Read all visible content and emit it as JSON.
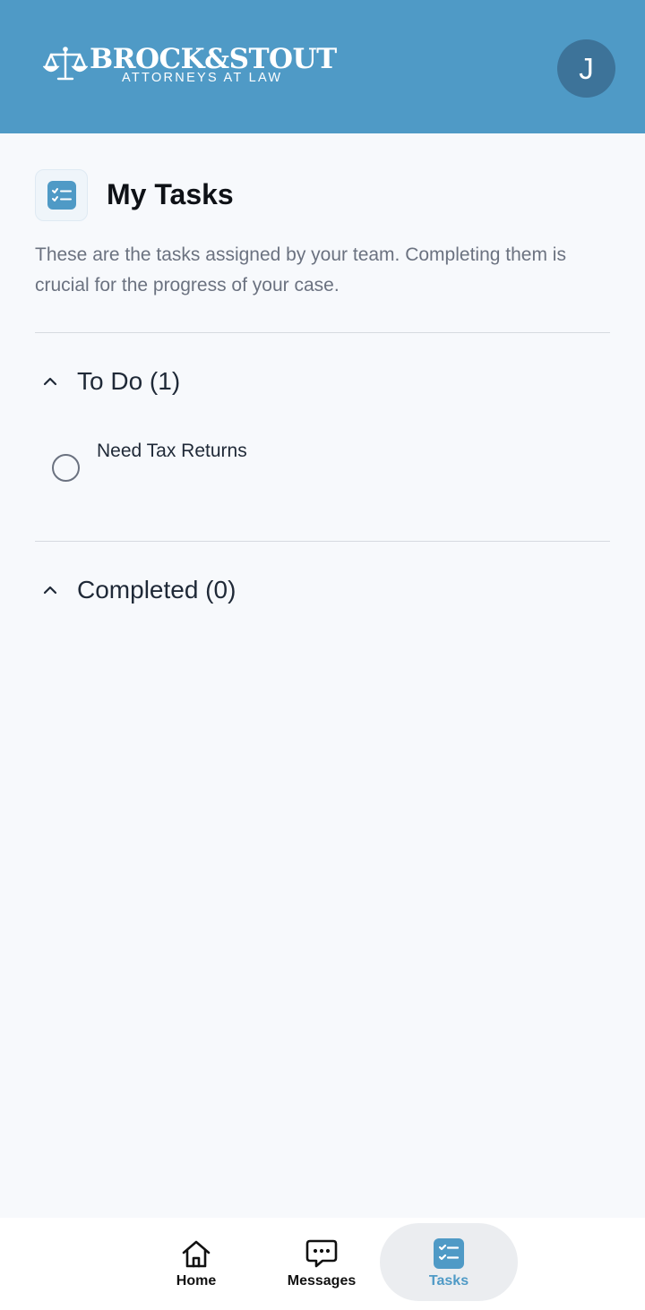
{
  "app": {
    "logo_text": "BROCK&STOUT",
    "logo_subtitle": "ATTORNEYS AT LAW",
    "avatar_initial": "J"
  },
  "page": {
    "title": "My Tasks",
    "description": "These are the tasks assigned by your team. Completing them is crucial for the progress of your case."
  },
  "sections": {
    "todo": {
      "label": "To Do (1)",
      "tasks": [
        {
          "label": "Need Tax Returns",
          "completed": false
        }
      ]
    },
    "completed": {
      "label": "Completed (0)"
    }
  },
  "nav": {
    "items": [
      {
        "label": "Home",
        "icon": "home-icon",
        "active": false
      },
      {
        "label": "Messages",
        "icon": "chat-icon",
        "active": false
      },
      {
        "label": "Tasks",
        "icon": "tasks-icon",
        "active": true
      }
    ]
  },
  "colors": {
    "brand": "#4f9ac6",
    "avatar": "#3d7399",
    "background": "#f7f9fc",
    "muted_text": "#6b7280"
  }
}
